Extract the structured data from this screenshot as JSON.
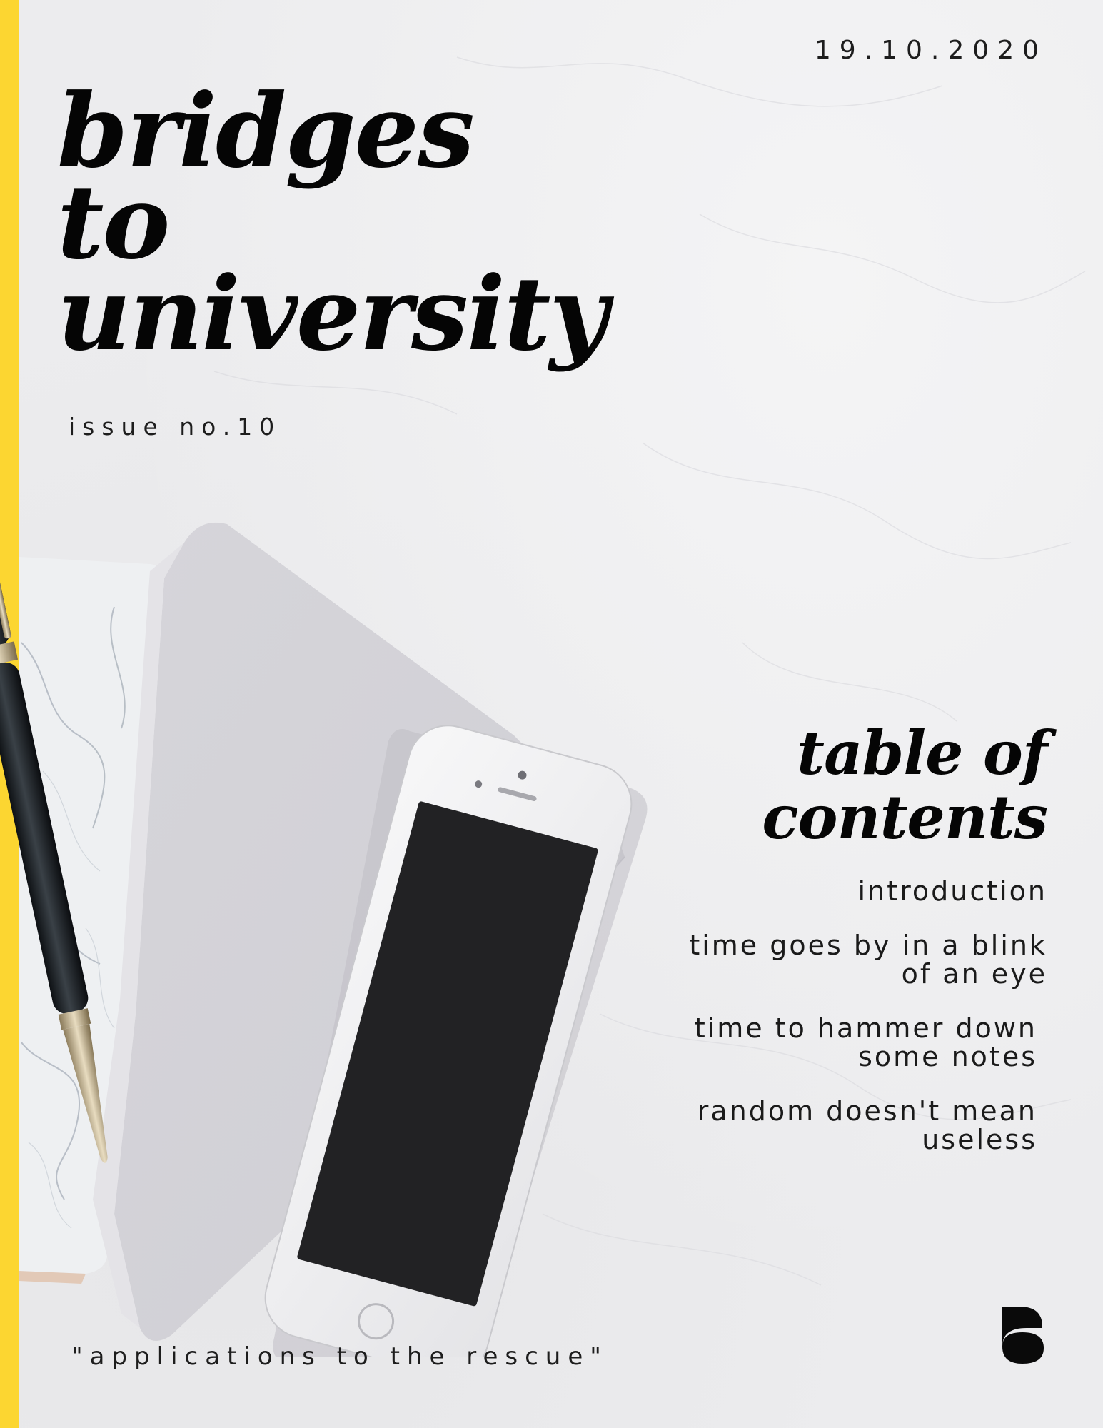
{
  "cover": {
    "date": "19.10.2020",
    "title_lines": [
      "bridges",
      "to",
      "university"
    ],
    "issue": "issue no.10",
    "toc": {
      "heading_lines": [
        "table of",
        "contents"
      ],
      "items": [
        "introduction",
        "time goes by in a blink \nof an eye",
        "time to hammer down\nsome notes",
        "random doesn't mean\nuseless"
      ]
    },
    "tagline": "\"applications to the rescue\"",
    "icons": [
      "logo-mark-icon"
    ],
    "colors": {
      "accent": "#fcd631",
      "text": "#050505",
      "background": "#ececee"
    }
  }
}
